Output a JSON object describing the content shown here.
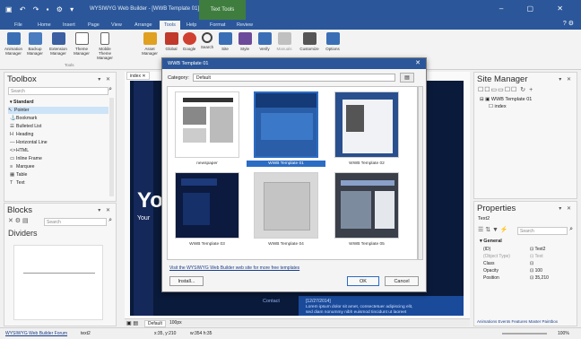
{
  "app": {
    "window_title": "WYSIWYG Web Builder - [WWB Template 01]",
    "context_tab": "Text Tools",
    "qa_icons": [
      "app-icon",
      "undo-icon",
      "redo-icon",
      "save-icon",
      "gear-icon",
      "dropdown-icon"
    ]
  },
  "ribbon_tabs": [
    "File",
    "Home",
    "Insert",
    "Page",
    "View",
    "Arrange",
    "Tools",
    "Help",
    "Format",
    "Review"
  ],
  "active_tab": "Tools",
  "ribbon_buttons": [
    {
      "label": "Animation Manager",
      "icon": "animation-icon",
      "color": "#3a6fb5"
    },
    {
      "label": "Backup Manager",
      "icon": "backup-icon",
      "color": "#4a7cc0"
    },
    {
      "label": "Extension Manager",
      "icon": "extension-icon",
      "color": "#3b5fa0"
    },
    {
      "label": "Theme Manager",
      "icon": "theme-icon",
      "color": "#6a6a6a"
    },
    {
      "label": "Mobile Theme Manager",
      "icon": "mobile-theme-icon",
      "color": "#6a6a6a"
    },
    {
      "label": "Asset Manager",
      "icon": "asset-icon",
      "color": "#e0a020"
    },
    {
      "label": "Global",
      "icon": "global-icon",
      "color": "#c0392b"
    },
    {
      "label": "Google",
      "icon": "google-icon",
      "color": "#d04030"
    },
    {
      "label": "Search",
      "icon": "search-icon",
      "color": "#444"
    },
    {
      "label": "Site",
      "icon": "site-icon",
      "color": "#3a6fb5"
    },
    {
      "label": "Style",
      "icon": "style-icon",
      "color": "#6c4b9a"
    },
    {
      "label": "Verify",
      "icon": "verify-icon",
      "color": "#3a6fb5"
    },
    {
      "label": "Manuals",
      "icon": "manuals-icon",
      "color": "#c0c0c0"
    },
    {
      "label": "Customize",
      "icon": "customize-icon",
      "color": "#555"
    },
    {
      "label": "Options",
      "icon": "options-icon",
      "color": "#3a6fb5"
    }
  ],
  "ribbon_group_label": "Tools",
  "toolbox": {
    "title": "Toolbox",
    "search_placeholder": "Search",
    "section": "Standard",
    "items": [
      {
        "label": "Pointer",
        "icon": "pointer-icon"
      },
      {
        "label": "Bookmark",
        "icon": "anchor-icon"
      },
      {
        "label": "Bulleted List",
        "icon": "bulleted-list-icon"
      },
      {
        "label": "Heading",
        "icon": "heading-icon"
      },
      {
        "label": "Horizontal Line",
        "icon": "horizontal-line-icon"
      },
      {
        "label": "HTML",
        "icon": "html-icon"
      },
      {
        "label": "Inline Frame",
        "icon": "inline-frame-icon"
      },
      {
        "label": "Marquee",
        "icon": "marquee-icon"
      },
      {
        "label": "Table",
        "icon": "table-icon"
      },
      {
        "label": "Text",
        "icon": "text-icon"
      }
    ]
  },
  "blocks": {
    "title": "Blocks",
    "search_placeholder": "Search",
    "category": "Dividers"
  },
  "editor_tab": "index",
  "dialog": {
    "title": "WWB Template 01",
    "category_label": "Category:",
    "category_value": "Default",
    "templates": [
      {
        "name": "newspaper",
        "style": "light"
      },
      {
        "name": "WWB Template 01",
        "style": "blue",
        "selected": true
      },
      {
        "name": "WWB Template 02",
        "style": "blue-article"
      },
      {
        "name": "WWB Template 03",
        "style": "navy"
      },
      {
        "name": "WWB Template 04",
        "style": "grey"
      },
      {
        "name": "WWB Template 05",
        "style": "photo"
      }
    ],
    "link_text": "Visit the WYSIWYG Web Builder web site for more free templates",
    "install_label": "Install...",
    "ok_label": "OK",
    "cancel_label": "Cancel"
  },
  "canvas_texts": {
    "big_heading": "Yo",
    "sub_heading": "Your",
    "contact": "Contact",
    "date": "[12/27/2014]",
    "lorem": "Lorem ipsum dolor sit amet, consectetuer adipiscing elit,",
    "lorem2": "sed diam nonummy nibh euismod tincidunt ut laoreet"
  },
  "site_manager": {
    "title": "Site Manager",
    "root": "WWB Template 01",
    "page": "index"
  },
  "properties": {
    "title": "Properties",
    "object": "Text2",
    "search_placeholder": "Search",
    "section": "General",
    "rows": [
      {
        "key": "(ID)",
        "value": "Text2"
      },
      {
        "key": "(Object Type)",
        "value": "Text"
      },
      {
        "key": "Class",
        "value": ""
      },
      {
        "key": "Opacity",
        "value": "100"
      },
      {
        "key": "Position",
        "value": "35,210"
      }
    ],
    "footer_links": "Animations  Events  Features  Master  Paintbox"
  },
  "editor_bottom": {
    "tab_default": "Default",
    "zoom": "100px"
  },
  "status": {
    "link": "WYSIWYG Web Builder Forum",
    "object": "text2",
    "coords": "x:35, y:210",
    "size": "w:354 h:35",
    "zoom": "100%"
  },
  "colors": {
    "accent": "#2b579a",
    "context_tab": "#3f7d3f",
    "canvas_dark": "#0a1a3a",
    "selection": "#2b6cc4"
  }
}
